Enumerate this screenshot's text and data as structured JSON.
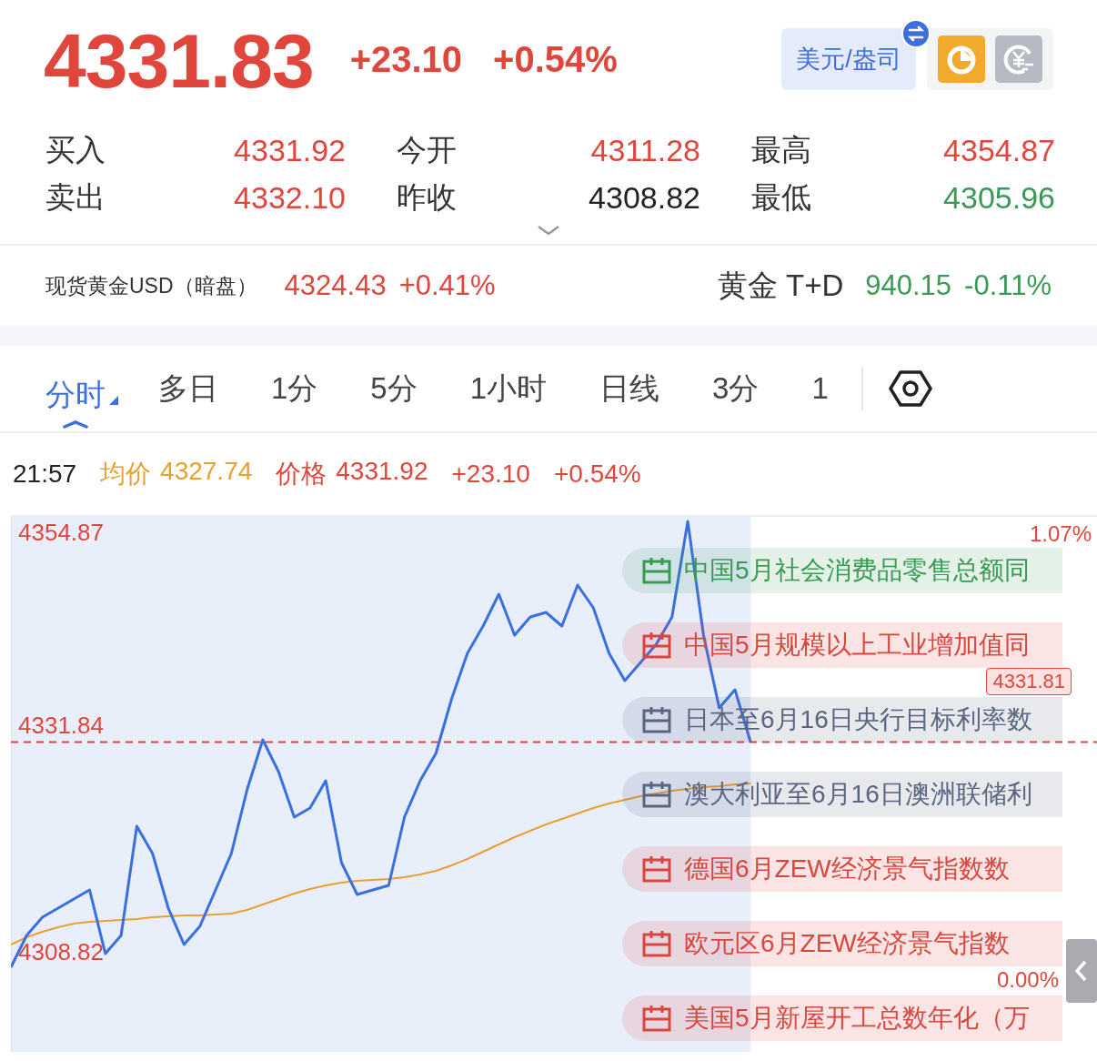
{
  "quote": {
    "price": "4331.83",
    "change": "+23.10",
    "change_pct": "+0.54%"
  },
  "unit_button": {
    "label": "美元/盎司"
  },
  "details": [
    {
      "label": "买入",
      "value": "4331.92",
      "color": "#e0463c"
    },
    {
      "label": "今开",
      "value": "4311.28",
      "color": "#e0463c"
    },
    {
      "label": "最高",
      "value": "4354.87",
      "color": "#e0463c"
    },
    {
      "label": "卖出",
      "value": "4332.10",
      "color": "#e0463c"
    },
    {
      "label": "昨收",
      "value": "4308.82",
      "color": "#222222"
    },
    {
      "label": "最低",
      "value": "4305.96",
      "color": "#3a9a55"
    }
  ],
  "related": [
    {
      "name": "现货黄金USD（暗盘）",
      "price": "4324.43",
      "change_pct": "+0.41%",
      "color": "#e0463c"
    },
    {
      "name": "黄金 T+D",
      "price": "940.15",
      "change_pct": "-0.11%",
      "color": "#3a9a55"
    }
  ],
  "tabs": [
    {
      "label": "分时",
      "selected": true
    },
    {
      "label": "多日",
      "selected": false
    },
    {
      "label": "1分",
      "selected": false
    },
    {
      "label": "5分",
      "selected": false
    },
    {
      "label": "1小时",
      "selected": false
    },
    {
      "label": "日线",
      "selected": false
    },
    {
      "label": "3分",
      "selected": false
    },
    {
      "label": "1",
      "selected": false
    }
  ],
  "info_line": [
    {
      "kind": "time",
      "value": "21:57",
      "color": "#222222"
    },
    {
      "kind": "legend",
      "value": "4327.74",
      "color": "#e8a030"
    },
    {
      "kind": "legend",
      "value": "4331.92",
      "color": "#e0463c"
    },
    {
      "kind": "change",
      "value": "+23.10",
      "color": "#e0463c"
    },
    {
      "kind": "change",
      "value": "+0.54%",
      "color": "#e0463c"
    }
  ],
  "chart": {
    "right_ticks": [
      "1.07%",
      "0.00%"
    ],
    "price_tag": "4331.81",
    "chart_data": {
      "type": "line",
      "ylim": [
        4297.8,
        4356.6
      ],
      "yticks": [
        {
          "value": 4354.87,
          "label": "4354.87"
        },
        {
          "value": 4308.82,
          "label": "4308.82"
        }
      ],
      "series": [
        {
          "name": "均价",
          "color": "#e8a030",
          "values": [
            4309.6,
            4310.4,
            4311.0,
            4311.5,
            4311.9,
            4312.1,
            4312.2,
            4312.3,
            4312.4,
            4312.6,
            4312.7,
            4312.8,
            4312.8,
            4312.9,
            4313.0,
            4313.4,
            4314.0,
            4314.6,
            4315.2,
            4315.7,
            4316.1,
            4316.4,
            4316.6,
            4316.7,
            4316.8,
            4317.0,
            4317.3,
            4317.7,
            4318.3,
            4319.0,
            4319.8,
            4320.6,
            4321.4,
            4322.1,
            4322.8,
            4323.4,
            4324.0,
            4324.6,
            4325.1,
            4325.5,
            4325.9,
            4326.2,
            4326.5,
            4326.7,
            4326.9,
            4327.0,
            4327.2,
            4327.3,
            null,
            null,
            null,
            null,
            null,
            null,
            null,
            null,
            null,
            null,
            null,
            null,
            null,
            null,
            null,
            null,
            null,
            null,
            null,
            null,
            null,
            null
          ]
        },
        {
          "name": "价格",
          "color": "#3b6fe0",
          "values": [
            4307.1,
            4310.6,
            4312.6,
            4313.6,
            4314.6,
            4315.6,
            4308.6,
            4310.6,
            4322.6,
            4319.6,
            4313.6,
            4309.6,
            4311.6,
            4315.6,
            4319.6,
            4326.6,
            4332.1,
            4328.6,
            4323.6,
            4324.6,
            4327.6,
            4318.6,
            4315.1,
            4315.6,
            4316.1,
            4323.6,
            4327.6,
            4330.6,
            4336.6,
            4341.6,
            4344.6,
            4348.1,
            4343.6,
            4345.6,
            4346.1,
            4344.6,
            4349.1,
            4346.6,
            4341.6,
            4338.6,
            4340.6,
            4342.6,
            4345.6,
            4356.1,
            4343.6,
            4335.6,
            4337.6,
            4331.8,
            null,
            null,
            null,
            null,
            null,
            null,
            null,
            null,
            null,
            null,
            null,
            null,
            null,
            null,
            null,
            null,
            null,
            null,
            null,
            null,
            null,
            null
          ]
        }
      ],
      "ref_lines": [
        {
          "axis": "y",
          "value": 4331.84,
          "label": "4331.84"
        }
      ]
    },
    "events": [
      {
        "text": "中国5月社会消费品零售总额同",
        "color": "#3a9a55"
      },
      {
        "text": "中国5月规模以上工业增加值同",
        "color": "#d9463e"
      },
      {
        "text": "日本至6月16日央行目标利率数",
        "color": "#5a6580"
      },
      {
        "text": "澳大利亚至6月16日澳洲联储利",
        "color": "#5a6580"
      },
      {
        "text": "德国6月ZEW经济景气指数数",
        "color": "#d9463e"
      },
      {
        "text": "欧元区6月ZEW经济景气指数",
        "color": "#d9463e"
      },
      {
        "text": "美国5月新屋开工总数年化（万",
        "color": "#d9463e"
      }
    ]
  }
}
